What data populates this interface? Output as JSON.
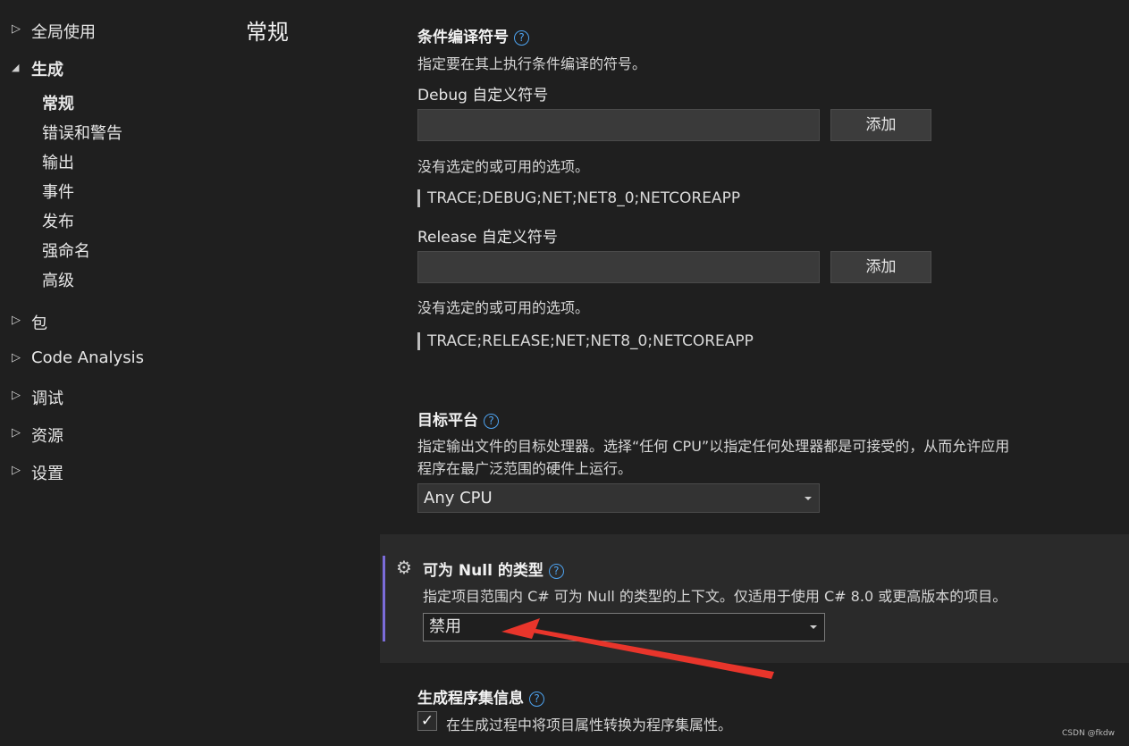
{
  "sidebar": {
    "items": [
      {
        "label": "全局使用",
        "expander": "collapsed"
      },
      {
        "label": "生成",
        "expander": "expanded",
        "bold": true
      },
      {
        "label": "常规",
        "selected": true
      },
      {
        "label": "错误和警告"
      },
      {
        "label": "输出"
      },
      {
        "label": "事件"
      },
      {
        "label": "发布"
      },
      {
        "label": "强命名"
      },
      {
        "label": "高级"
      },
      {
        "label": "包",
        "expander": "collapsed"
      },
      {
        "label": "Code Analysis",
        "expander": "collapsed"
      },
      {
        "label": "调试",
        "expander": "collapsed"
      },
      {
        "label": "资源",
        "expander": "collapsed"
      },
      {
        "label": "设置",
        "expander": "collapsed"
      }
    ]
  },
  "page_title": "常规",
  "conditional": {
    "title": "条件编译符号",
    "help": "?",
    "description": "指定要在其上执行条件编译的符号。",
    "debug": {
      "label": "Debug 自定义符号",
      "input_value": "",
      "add_button": "添加",
      "empty_text": "没有选定的或可用的选项。",
      "symbols": "TRACE;DEBUG;NET;NET8_0;NETCOREAPP"
    },
    "release": {
      "label": "Release 自定义符号",
      "input_value": "",
      "add_button": "添加",
      "empty_text": "没有选定的或可用的选项。",
      "symbols": "TRACE;RELEASE;NET;NET8_0;NETCOREAPP"
    }
  },
  "platform": {
    "title": "目标平台",
    "help": "?",
    "description_line1": "指定输出文件的目标处理器。选择“任何 CPU”以指定任何处理器都是可接受的，从而允许应用",
    "description_line2": "程序在最广泛范围的硬件上运行。",
    "selected": "Any CPU"
  },
  "nullable": {
    "title": "可为 Null 的类型",
    "help": "?",
    "description": "指定项目范围内 C# 可为 Null 的类型的上下文。仅适用于使用 C# 8.0 或更高版本的项目。",
    "selected": "禁用"
  },
  "assembly": {
    "title": "生成程序集信息",
    "help": "?",
    "checkbox_label": "在生成过程中将项目属性转换为程序集属性。",
    "checked": true,
    "check_glyph": "✓"
  },
  "icons": {
    "collapsed": "▷",
    "expanded": "◢",
    "gear": "⚙"
  },
  "watermark": "CSDN @fkdw",
  "colors": {
    "accent_bar": "#7b6cd9",
    "help_icon": "#4ea3f0",
    "annotation_arrow": "#e8352b"
  }
}
